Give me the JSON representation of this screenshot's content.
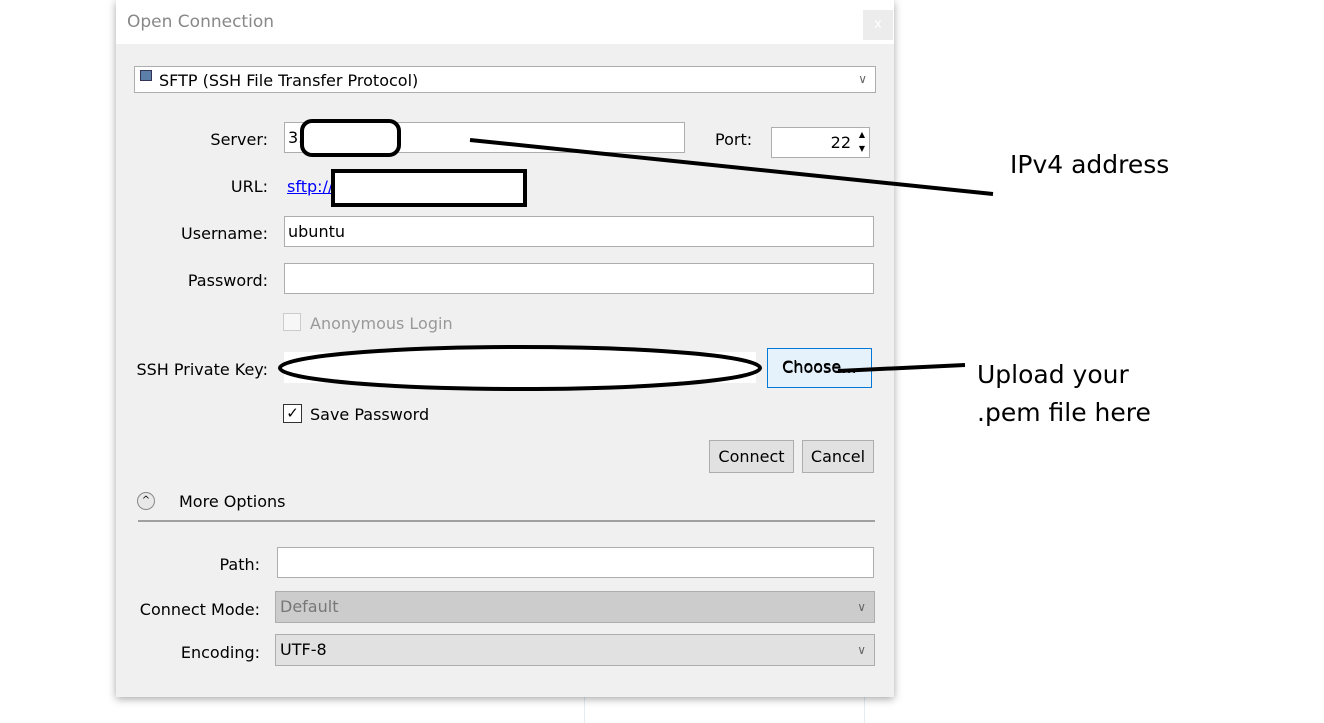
{
  "window": {
    "title": "Open Connection",
    "close_label": "x"
  },
  "protocol": {
    "value": "SFTP (SSH File Transfer Protocol)"
  },
  "server": {
    "label": "Server:",
    "value": "3."
  },
  "port": {
    "label": "Port:",
    "value": "22"
  },
  "url": {
    "label": "URL:",
    "value": "sftp://"
  },
  "username": {
    "label": "Username:",
    "value": "ubuntu"
  },
  "password": {
    "label": "Password:",
    "value": ""
  },
  "anonymous": {
    "label": "Anonymous Login",
    "checked": false
  },
  "ssh_key": {
    "label": "SSH Private Key:",
    "value": "",
    "choose_label": "Choose..."
  },
  "save_password": {
    "label": "Save Password",
    "checked": true,
    "mark": "✓"
  },
  "buttons": {
    "connect": "Connect",
    "cancel": "Cancel"
  },
  "more_options": {
    "label": "More Options"
  },
  "path": {
    "label": "Path:",
    "value": ""
  },
  "connect_mode": {
    "label": "Connect Mode:",
    "value": "Default"
  },
  "encoding": {
    "label": "Encoding:",
    "value": "UTF-8"
  },
  "annotations": {
    "ipv4": "IPv4 address",
    "pem_line1": "Upload your",
    "pem_line2": ".pem file here"
  }
}
